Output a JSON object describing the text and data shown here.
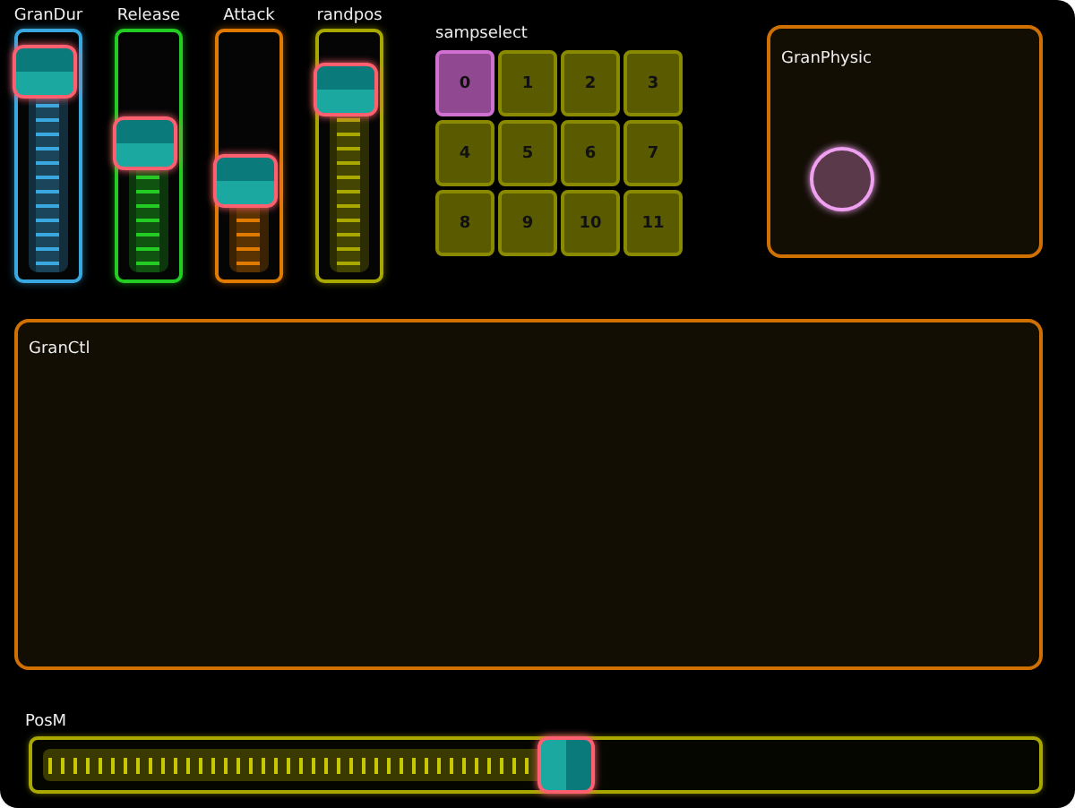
{
  "faders": [
    {
      "label": "GranDur",
      "color": "#3aa8e0",
      "level": 0.84
    },
    {
      "label": "Release",
      "color": "#22cc22",
      "level": 0.55
    },
    {
      "label": "Attack",
      "color": "#e07a00",
      "level": 0.4
    },
    {
      "label": "randpos",
      "color": "#a8a800",
      "level": 0.77
    }
  ],
  "sampselect": {
    "label": "sampselect",
    "pads": [
      {
        "label": "0",
        "selected": true
      },
      {
        "label": "1",
        "selected": false
      },
      {
        "label": "2",
        "selected": false
      },
      {
        "label": "3",
        "selected": false
      },
      {
        "label": "4",
        "selected": false
      },
      {
        "label": "5",
        "selected": false
      },
      {
        "label": "6",
        "selected": false
      },
      {
        "label": "7",
        "selected": false
      },
      {
        "label": "8",
        "selected": false
      },
      {
        "label": "9",
        "selected": false
      },
      {
        "label": "10",
        "selected": false
      },
      {
        "label": "11",
        "selected": false
      }
    ]
  },
  "physics": {
    "title": "GranPhysic"
  },
  "gran_ctl": {
    "title": "GranCtl"
  },
  "pos_slider": {
    "label": "PosM",
    "level": 0.53
  }
}
